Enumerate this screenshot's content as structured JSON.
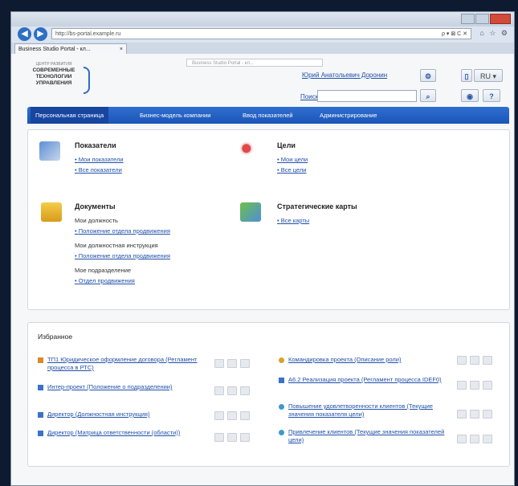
{
  "browser": {
    "address": "http://bs-portal.example.ru",
    "address_controls": "ρ ▾ ⊠ C ✕",
    "tab_title": "Business Studio Portal - кл...",
    "tab_close": "×",
    "right_icons": "⌂ ☆ ⚙",
    "back_glyph": "◀",
    "forward_glyph": "▶"
  },
  "site": {
    "logo_small": "ЦЕНТР РАЗВИТИЯ",
    "logo_lines": [
      "СОВРЕМЕННЫЕ",
      "ТЕХНОЛОГИИ",
      "УПРАВЛЕНИЯ"
    ],
    "breadcrumb": "Business Studio Portal - кл...",
    "user_name": "Юрий Анатольевич Доронин",
    "search_label": "Поиск",
    "lang": "RU ▾",
    "buttons": {
      "settings": "⚙",
      "search": "⌕",
      "eye": "◉",
      "help": "?",
      "phone": "▯"
    }
  },
  "menu": [
    "Персональная страница",
    "Бизнес-модель компании",
    "Ввод показателей",
    "Администрирование"
  ],
  "sections": {
    "indicators": {
      "title": "Показатели",
      "links": [
        "Мои показатели",
        "Все показатели"
      ]
    },
    "goals": {
      "title": "Цели",
      "links": [
        "Мои цели",
        "Все цели"
      ]
    },
    "documents": {
      "title": "Документы",
      "sub1": "Мои должность",
      "link1": "Положение отдела продвижения",
      "sub2": "Мои должностная инструкция",
      "link2": "Положение отдела продвижения",
      "sub3": "Мое подразделение",
      "link3": "Отдел продвижения"
    },
    "strategy": {
      "title": "Стратегические карты",
      "links": [
        "Все карты"
      ]
    }
  },
  "favorites": {
    "title": "Избранное",
    "left": [
      {
        "text": "ТП1 Юридическое оформление договора (Регламент процесса в РТС)",
        "icon_color": "#d9892a"
      },
      {
        "text": "Интер-проект (Положение о подразделении)",
        "icon_color": "#3a72c8"
      },
      {
        "text": "Директор (Должностная инструкция)",
        "icon_color": "#3a72c8"
      },
      {
        "text": "Директор (Матрица ответственности (области))",
        "icon_color": "#3a72c8"
      }
    ],
    "right": [
      {
        "text": "Командировка проекта (Описание роли)",
        "icon_color": "#d9a22a"
      },
      {
        "text": "А6.2 Реализация проекта (Регламент процесса IDEF0)",
        "icon_color": "#3a72c8"
      },
      {
        "text": "Повышение удовлетворенности клиентов (Текущие значения показателя цели)",
        "icon_color": "#3a9ad0"
      },
      {
        "text": "Привлечение клиентов (Текущие значения показателей цели)",
        "icon_color": "#3a9ad0"
      }
    ]
  }
}
